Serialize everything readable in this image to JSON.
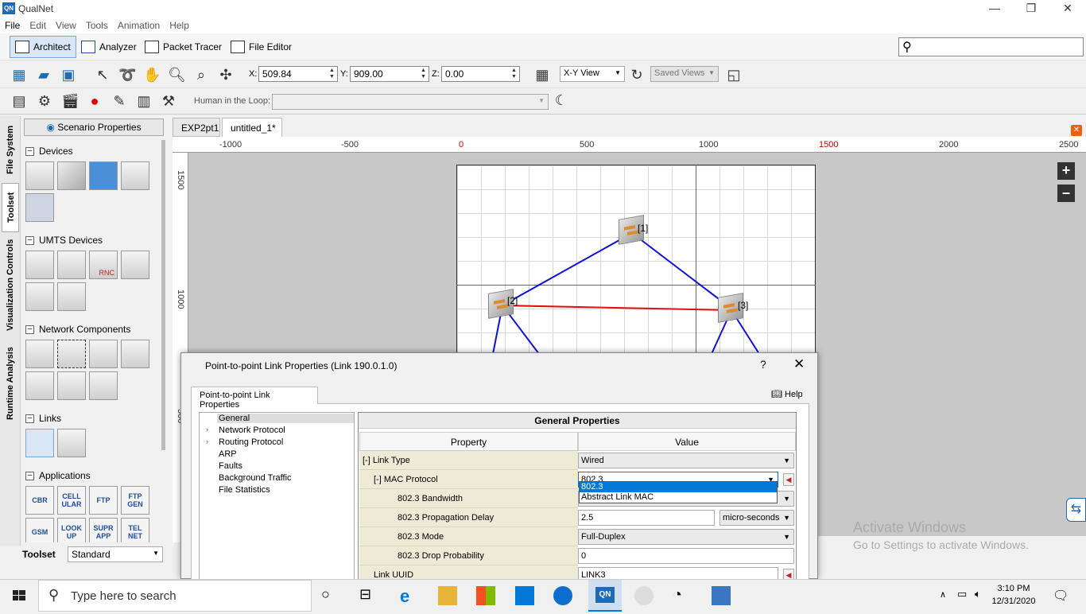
{
  "app": {
    "title": "QualNet",
    "icon_text": "QN"
  },
  "menu": [
    "File",
    "Edit",
    "View",
    "Tools",
    "Animation",
    "Help"
  ],
  "modes": [
    {
      "label": "Architect",
      "active": true
    },
    {
      "label": "Analyzer"
    },
    {
      "label": "Packet Tracer"
    },
    {
      "label": "File Editor"
    }
  ],
  "coords": {
    "x_label": "X:",
    "x": "509.84",
    "y_label": "Y:",
    "y": "909.00",
    "z_label": "Z:",
    "z": "0.00",
    "view": "X-Y View",
    "saved_views": "Saved Views"
  },
  "hil": {
    "label": "Human in the Loop:"
  },
  "vtabs": [
    "File System",
    "Toolset",
    "Visualization Controls",
    "Runtime Analysis"
  ],
  "left": {
    "scenario_button": "Scenario Properties",
    "sections": {
      "devices": "Devices",
      "umts": "UMTS Devices",
      "network": "Network Components",
      "links": "Links",
      "applications": "Applications"
    },
    "apps": [
      "CBR",
      "CELL ULAR",
      "FTP",
      "FTP GEN",
      "GSM",
      "LOOK UP",
      "SUPR APP",
      "TEL NET"
    ],
    "rnc": "RNC",
    "toolset_label": "Toolset",
    "toolset_value": "Standard"
  },
  "tabs": [
    "EXP2pt1",
    "untitled_1*"
  ],
  "ruler": [
    "-1000",
    "-500",
    "0",
    "500",
    "1000",
    "1500",
    "2000",
    "2500"
  ],
  "vruler": [
    "1500",
    "1000",
    "500"
  ],
  "nodes": [
    {
      "label": "[1]"
    },
    {
      "label": "[2]"
    },
    {
      "label": "[3]"
    }
  ],
  "watermark": {
    "line1": "Activate Windows",
    "line2": "Go to Settings to activate Windows."
  },
  "dialog": {
    "title": "Point-to-point Link Properties (Link 190.0.1.0)",
    "help_q": "?",
    "close": "✕",
    "tab": "Point-to-point Link Properties",
    "help": "Help",
    "tree": [
      "General",
      "Network Protocol",
      "Routing Protocol",
      "ARP",
      "Faults",
      "Background Traffic",
      "File Statistics"
    ],
    "header": "General Properties",
    "col_property": "Property",
    "col_value": "Value",
    "rows": [
      {
        "label": "[-] Link Type",
        "value": "Wired"
      },
      {
        "label": "[-] MAC Protocol",
        "value": "802.3"
      },
      {
        "label": "802.3 Bandwidth",
        "value": ""
      },
      {
        "label": "802.3 Propagation Delay",
        "value": "2.5",
        "unit": "micro-seconds"
      },
      {
        "label": "802.3 Mode",
        "value": "Full-Duplex"
      },
      {
        "label": "802.3 Drop Probability",
        "value": "0"
      },
      {
        "label": "Link UUID",
        "value": "LINK3"
      }
    ],
    "dropdown": [
      "802.3",
      "Abstract Link MAC"
    ]
  },
  "taskbar": {
    "search": "Type here to search",
    "time": "3:10 PM",
    "date": "12/31/2020"
  },
  "colors": {
    "link_blue": "#1010dd",
    "link_red": "#e01010",
    "accent": "#0078d7"
  }
}
